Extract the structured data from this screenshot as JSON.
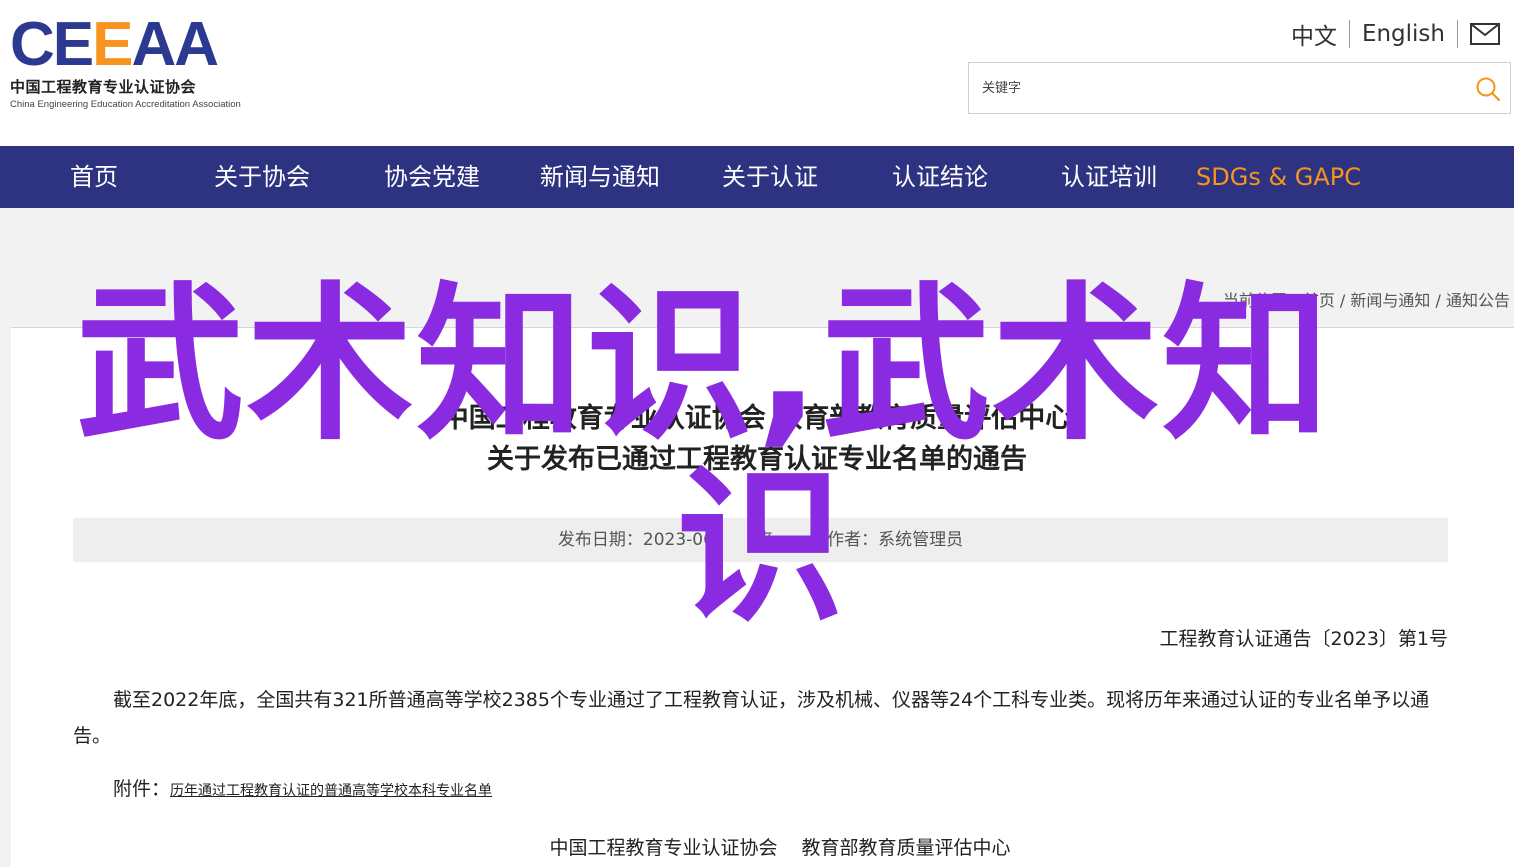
{
  "logo": {
    "mark_part1": "CE",
    "mark_part2": "E",
    "mark_part3": "AA",
    "name_cn": "中国工程教育专业认证协会",
    "name_en": "China Engineering Education Accreditation Association"
  },
  "lang": {
    "zh": "中文",
    "en": "English",
    "mail_icon": "mail-icon"
  },
  "search": {
    "placeholder": "关键字",
    "icon": "search-icon"
  },
  "nav": {
    "items": [
      "首页",
      "关于协会",
      "协会党建",
      "新闻与通知",
      "关于认证",
      "认证结论",
      "认证培训",
      "SDGs & GAPC"
    ],
    "highlight_color": "#f7941d",
    "bg_color": "#2d3380"
  },
  "breadcrumb": {
    "prefix": "当前位置：",
    "home": "首页",
    "sep1": " / ",
    "section": "新闻与通知",
    "sep2": " / ",
    "current": "通知公告"
  },
  "article": {
    "title_line1": "中国工程教育专业认证协会 教育部教育质量评估中心",
    "title_line2": "关于发布已通过工程教育认证专业名单的通告",
    "meta_date": "发布日期：2023-06-",
    "meta_source": "来",
    "meta_author": "作者：系统管理员",
    "doc_number": "工程教育认证通告〔2023〕第1号",
    "paragraph": "截至2022年底，全国共有321所普通高等学校2385个专业通过了工程教育认证，涉及机械、仪器等24个工科专业类。现将历年来通过认证的专业名单予以通告。",
    "attachment_label": "附件：",
    "attachment_link": "历年通过工程教育认证的普通高等学校本科专业名单",
    "signer1": "中国工程教育专业认证协会",
    "signer2": "教育部教育质量评估中心"
  },
  "overlay": {
    "line1": "武术知识,武术知",
    "line2": "识",
    "color": "#8a2be2"
  }
}
